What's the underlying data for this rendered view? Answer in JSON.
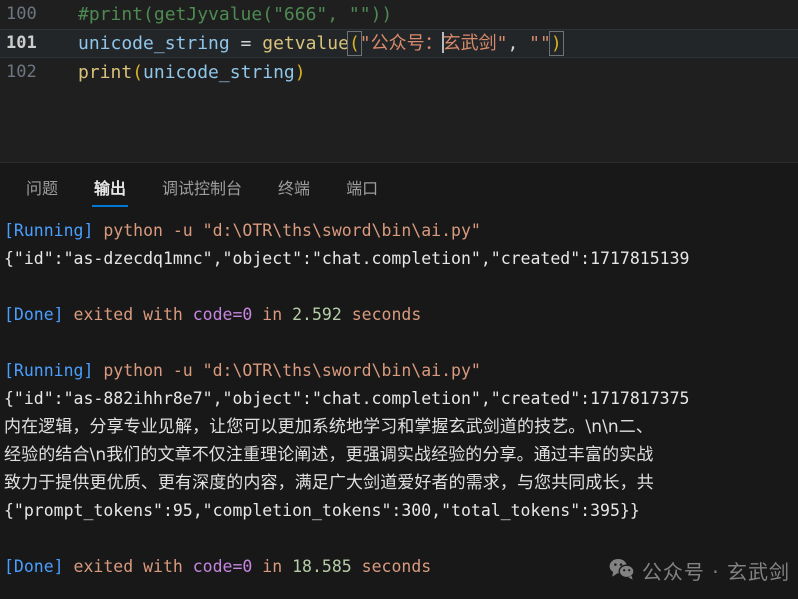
{
  "editor": {
    "lines": [
      {
        "number": "100",
        "active": false,
        "segments": [
          {
            "text": "#print(getJyvalue(\"666\", \"\"))",
            "style": "comment"
          }
        ]
      },
      {
        "number": "101",
        "active": true,
        "segments": [
          {
            "text": "unicode_string",
            "style": "var"
          },
          {
            "text": " = ",
            "style": "op"
          },
          {
            "text": "getvalue",
            "style": "fn"
          },
          {
            "text": "(",
            "style": "paren-y-box"
          },
          {
            "text": "\"公众号：",
            "style": "str"
          },
          {
            "text": "CURSOR",
            "style": "caret"
          },
          {
            "text": "玄武剑\"",
            "style": "str"
          },
          {
            "text": ", ",
            "style": "punct"
          },
          {
            "text": "\"\"",
            "style": "str"
          },
          {
            "text": ")",
            "style": "paren-y-box"
          }
        ]
      },
      {
        "number": "102",
        "active": false,
        "segments": [
          {
            "text": "print",
            "style": "fn"
          },
          {
            "text": "(",
            "style": "paren-y"
          },
          {
            "text": "unicode_string",
            "style": "var"
          },
          {
            "text": ")",
            "style": "paren-y"
          }
        ]
      }
    ]
  },
  "panel": {
    "tabs": [
      {
        "label": "问题",
        "active": false
      },
      {
        "label": "输出",
        "active": true
      },
      {
        "label": "调试控制台",
        "active": false
      },
      {
        "label": "终端",
        "active": false
      },
      {
        "label": "端口",
        "active": false
      }
    ],
    "accent_color": "#0078d4"
  },
  "output": {
    "lines": [
      {
        "kind": "run",
        "segments": [
          {
            "text": "[Running]",
            "style": "tag"
          },
          {
            "text": " python -u \"d:\\OTR\\ths\\sword\\bin\\ai.py\"",
            "style": "plain"
          }
        ]
      },
      {
        "kind": "json",
        "segments": [
          {
            "text": "{\"id\":\"as-dzecdq1mnc\",\"object\":\"chat.completion\",\"created\":1717815139",
            "style": "json"
          }
        ]
      },
      {
        "kind": "blank",
        "segments": []
      },
      {
        "kind": "done",
        "segments": [
          {
            "text": "[Done]",
            "style": "tag"
          },
          {
            "text": " exited with ",
            "style": "plain"
          },
          {
            "text": "code=0",
            "style": "code"
          },
          {
            "text": " in ",
            "style": "plain"
          },
          {
            "text": "2.592",
            "style": "num"
          },
          {
            "text": " seconds",
            "style": "plain"
          }
        ]
      },
      {
        "kind": "blank",
        "segments": []
      },
      {
        "kind": "run",
        "segments": [
          {
            "text": "[Running]",
            "style": "tag"
          },
          {
            "text": " python -u \"d:\\OTR\\ths\\sword\\bin\\ai.py\"",
            "style": "plain"
          }
        ]
      },
      {
        "kind": "json",
        "segments": [
          {
            "text": "{\"id\":\"as-882ihhr8e7\",\"object\":\"chat.completion\",\"created\":1717817375",
            "style": "json"
          }
        ]
      },
      {
        "kind": "cn",
        "segments": [
          {
            "text": "内在逻辑，分享专业见解，让您可以更加系统地学习和掌握玄武剑道的技艺。\\n\\n二、",
            "style": "cn"
          }
        ]
      },
      {
        "kind": "cn",
        "segments": [
          {
            "text": "经验的结合\\n我们的文章不仅注重理论阐述，更强调实战经验的分享。通过丰富的实战",
            "style": "cn"
          }
        ]
      },
      {
        "kind": "cn",
        "segments": [
          {
            "text": "致力于提供更优质、更有深度的内容，满足广大剑道爱好者的需求，与您共同成长，共",
            "style": "cn"
          }
        ]
      },
      {
        "kind": "json",
        "segments": [
          {
            "text": "{\"prompt_tokens\":95,\"completion_tokens\":300,\"total_tokens\":395}}",
            "style": "json"
          }
        ]
      },
      {
        "kind": "blank",
        "segments": []
      },
      {
        "kind": "done",
        "segments": [
          {
            "text": "[Done]",
            "style": "tag"
          },
          {
            "text": " exited with ",
            "style": "plain"
          },
          {
            "text": "code=0",
            "style": "code"
          },
          {
            "text": " in ",
            "style": "plain"
          },
          {
            "text": "18.585",
            "style": "num"
          },
          {
            "text": " seconds",
            "style": "plain"
          }
        ]
      }
    ]
  },
  "watermark": {
    "icon": "wechat-icon",
    "text": "公众号 · 玄武剑"
  }
}
